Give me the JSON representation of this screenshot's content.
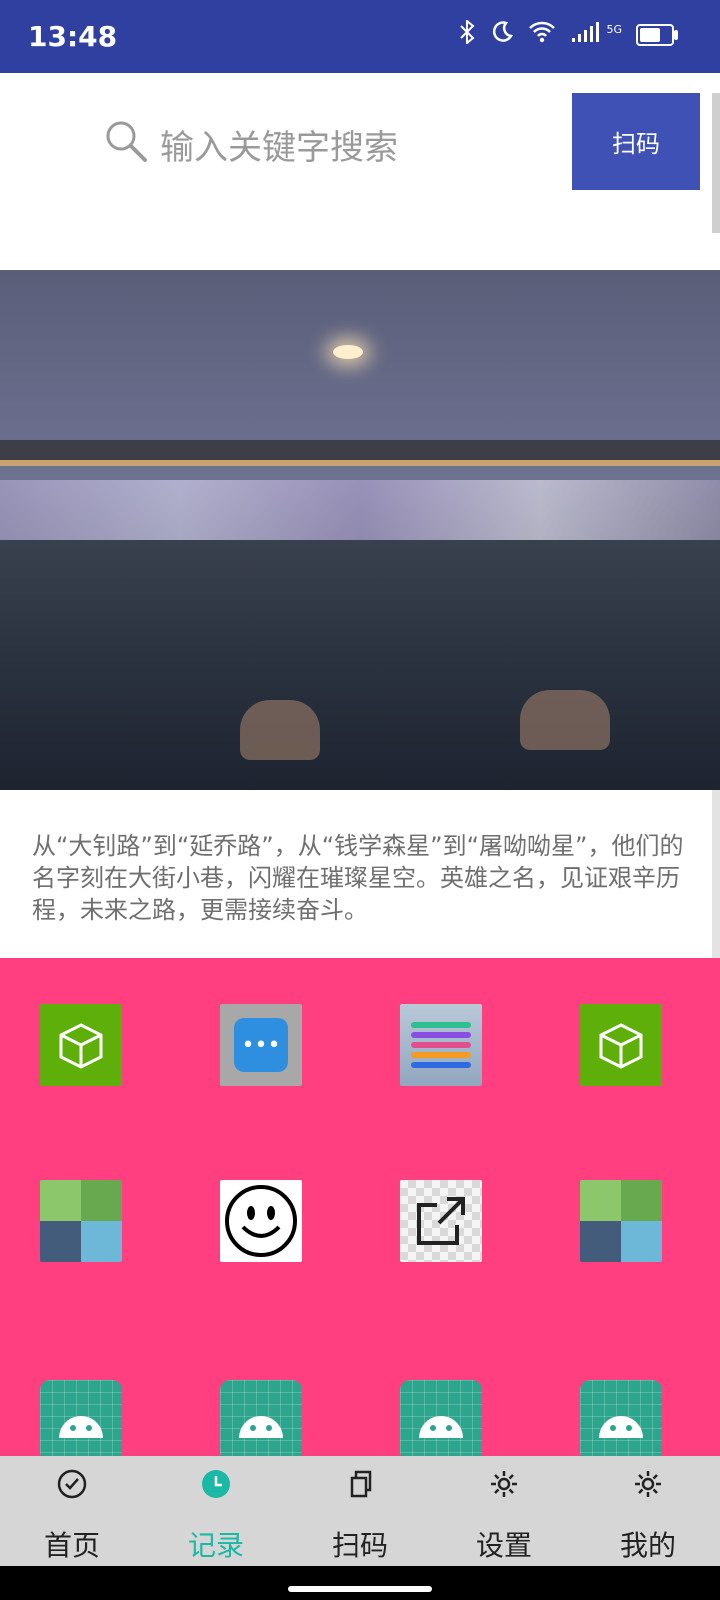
{
  "status_bar": {
    "time": "13:48",
    "network": "5G",
    "icons": [
      "bluetooth-icon",
      "moon-icon",
      "wifi-icon",
      "signal-icon",
      "battery-icon"
    ]
  },
  "search": {
    "placeholder": "输入关键字搜索",
    "scan_label": "扫码"
  },
  "article": {
    "text": "从“大钊路”到“延乔路”，从“钱学森星”到“屠呦呦星”，他们的名字刻在大街小巷，闪耀在璀璨星空。英雄之名，见证艰辛历程，未来之路，更需接续奋斗。"
  },
  "grid": {
    "background": "#FF3F7F",
    "apps": [
      {
        "icon": "axes-cube-icon"
      },
      {
        "icon": "chat-bubble-icon"
      },
      {
        "icon": "layers-icon"
      },
      {
        "icon": "axes-cube-icon"
      },
      {
        "icon": "tiles-icon"
      },
      {
        "icon": "smiley-icon"
      },
      {
        "icon": "share-icon"
      },
      {
        "icon": "tiles-icon"
      },
      {
        "icon": "android-icon"
      },
      {
        "icon": "android-icon"
      },
      {
        "icon": "android-icon"
      },
      {
        "icon": "android-icon"
      }
    ]
  },
  "bottom_nav": {
    "items": [
      {
        "label": "首页",
        "icon": "check-circle-icon"
      },
      {
        "label": "记录",
        "icon": "clock-icon",
        "active": true
      },
      {
        "label": "扫码",
        "icon": "copy-icon"
      },
      {
        "label": "设置",
        "icon": "gear-icon"
      },
      {
        "label": "我的",
        "icon": "gear-icon"
      }
    ],
    "active_color": "#1BB8A5"
  }
}
